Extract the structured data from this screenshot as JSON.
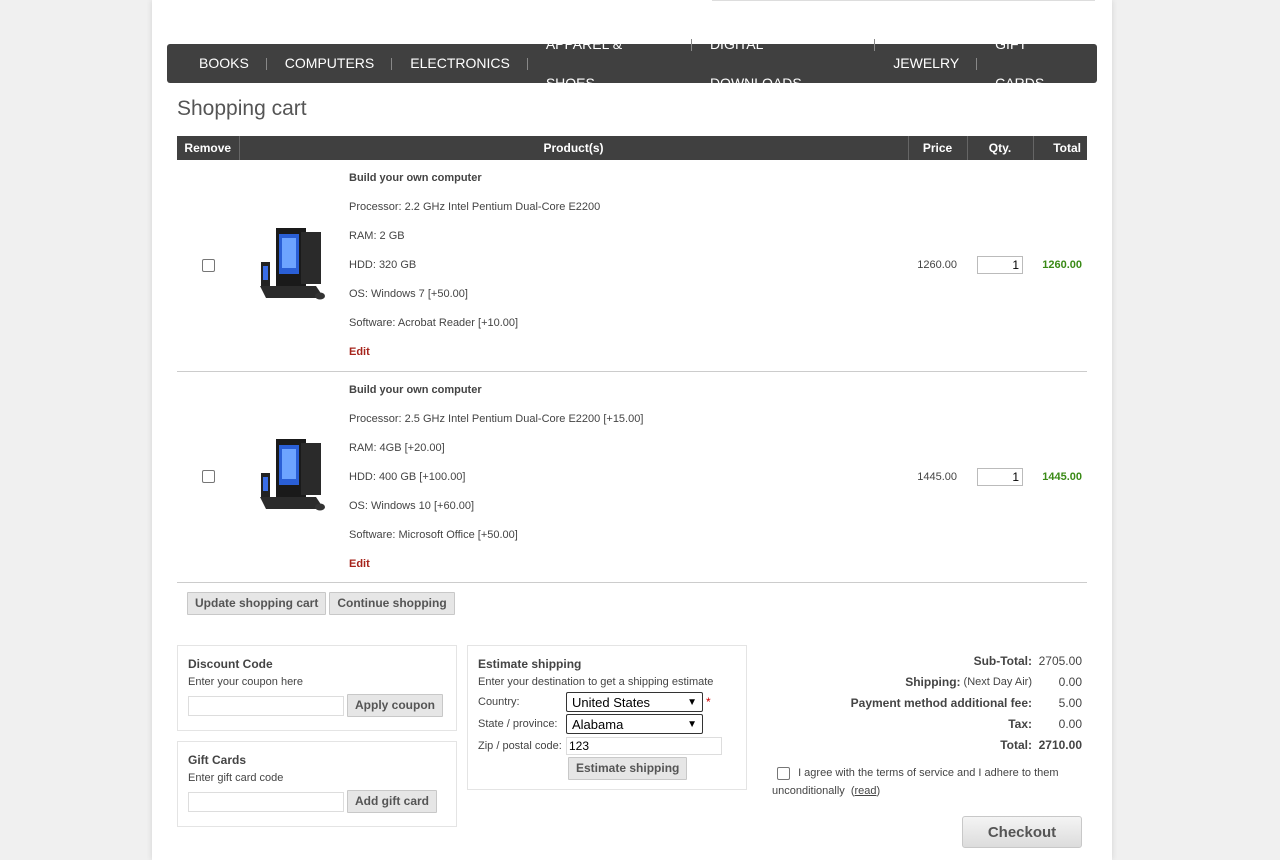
{
  "menu": [
    "BOOKS",
    "COMPUTERS",
    "ELECTRONICS",
    "APPAREL & SHOES",
    "DIGITAL DOWNLOADS",
    "JEWELRY",
    "GIFT CARDS"
  ],
  "page_title": "Shopping cart",
  "cart_headers": {
    "remove": "Remove",
    "products": "Product(s)",
    "price": "Price",
    "qty": "Qty.",
    "total": "Total"
  },
  "items": [
    {
      "name": "Build your own computer",
      "attributes": [
        "Processor: 2.2 GHz Intel Pentium Dual-Core E2200",
        "RAM: 2 GB",
        "HDD: 320 GB",
        "OS: Windows 7 [+50.00]",
        "Software: Acrobat Reader [+10.00]"
      ],
      "edit": "Edit",
      "price": "1260.00",
      "qty": "1",
      "total": "1260.00"
    },
    {
      "name": "Build your own computer",
      "attributes": [
        "Processor: 2.5 GHz Intel Pentium Dual-Core E2200 [+15.00]",
        "RAM: 4GB [+20.00]",
        "HDD: 400 GB [+100.00]",
        "OS: Windows 10 [+60.00]",
        "Software: Microsoft Office [+50.00]"
      ],
      "edit": "Edit",
      "price": "1445.00",
      "qty": "1",
      "total": "1445.00"
    }
  ],
  "buttons": {
    "update": "Update shopping cart",
    "continue": "Continue shopping"
  },
  "discount": {
    "title": "Discount Code",
    "hint": "Enter your coupon here",
    "button": "Apply coupon"
  },
  "giftcard": {
    "title": "Gift Cards",
    "hint": "Enter gift card code",
    "button": "Add gift card"
  },
  "shipping": {
    "title": "Estimate shipping",
    "hint": "Enter your destination to get a shipping estimate",
    "country_label": "Country:",
    "country_value": "United States",
    "required_mark": "*",
    "state_label": "State / province:",
    "state_value": "Alabama",
    "zip_label": "Zip / postal code:",
    "zip_value": "123",
    "button": "Estimate shipping"
  },
  "totals": {
    "subtotal_label": "Sub-Total:",
    "subtotal": "2705.00",
    "shipping_label": "Shipping:",
    "shipping_method": "(Next Day Air)",
    "shipping": "0.00",
    "payment_fee_label": "Payment method additional fee:",
    "payment_fee": "5.00",
    "tax_label": "Tax:",
    "tax": "0.00",
    "total_label": "Total:",
    "total": "2710.00"
  },
  "terms": {
    "text": "I agree with the terms of service and I adhere to them unconditionally",
    "open": "(",
    "link": "read",
    "close": ")"
  },
  "checkout": "Checkout",
  "colors": {
    "menu_bg": "#404040",
    "total_green": "#3a8a16",
    "edit_red": "#a6241c"
  }
}
